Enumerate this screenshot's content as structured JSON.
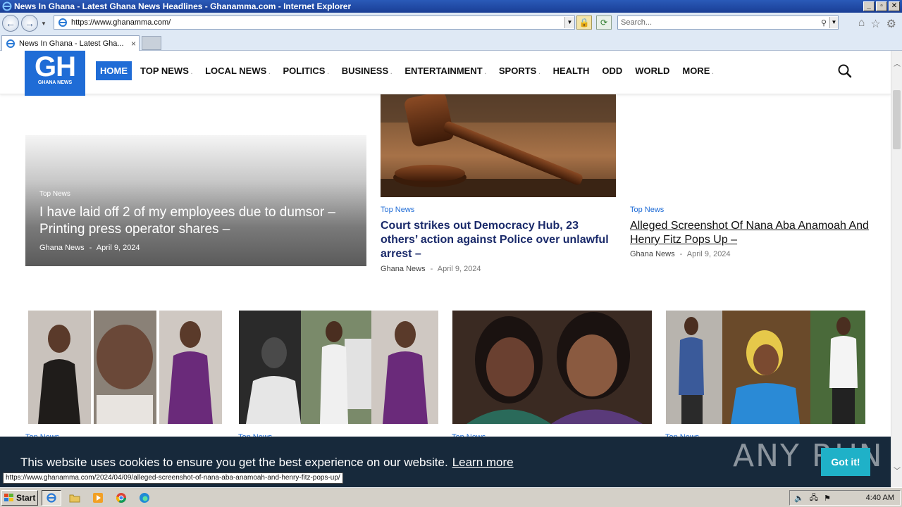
{
  "window": {
    "title": "News In Ghana - Latest Ghana News Headlines - Ghanamma.com - Internet Explorer",
    "buttons": {
      "minimize": "_",
      "maximize": "▫",
      "close": "✕"
    }
  },
  "addressbar": {
    "url": "https://www.ghanamma.com/",
    "search_placeholder": "Search..."
  },
  "tabs": [
    {
      "label": "News In Ghana - Latest Gha...",
      "close": "×"
    }
  ],
  "site": {
    "logo": {
      "main": "GH",
      "sub": "GHANA NEWS"
    },
    "menu": [
      {
        "label": "HOME",
        "active": true,
        "dropdown": false
      },
      {
        "label": "TOP NEWS",
        "dropdown": true
      },
      {
        "label": "LOCAL NEWS",
        "dropdown": true
      },
      {
        "label": "POLITICS",
        "dropdown": true
      },
      {
        "label": "BUSINESS",
        "dropdown": true
      },
      {
        "label": "ENTERTAINMENT",
        "dropdown": true
      },
      {
        "label": "SPORTS",
        "dropdown": true
      },
      {
        "label": "HEALTH",
        "dropdown": false
      },
      {
        "label": "ODD",
        "dropdown": false
      },
      {
        "label": "WORLD",
        "dropdown": false
      },
      {
        "label": "MORE",
        "dropdown": true
      }
    ],
    "dropdown_marker": "."
  },
  "featured": {
    "left": {
      "category": "Top News",
      "title": "I have laid off 2 of my employees due to dumsor – Printing press operator shares –",
      "author": "Ghana News",
      "sep": "-",
      "date": "April 9, 2024"
    },
    "mid": {
      "category": "Top News",
      "title": "Court strikes out Democracy Hub, 23 others’ action against Police over unlawful arrest –",
      "author": "Ghana News",
      "sep": "-",
      "date": "April 9, 2024"
    },
    "right": {
      "category": "Top News",
      "title": "Alleged Screenshot Of Nana Aba Anamoah And Henry Fitz Pops Up –",
      "author": "Ghana News",
      "sep": "-",
      "date": "April 9, 2024"
    }
  },
  "thumbs": [
    {
      "category": "Top News"
    },
    {
      "category": "Top News"
    },
    {
      "category": "Top News"
    },
    {
      "category": "Top News"
    }
  ],
  "cookie": {
    "message": "This website uses cookies to ensure you get the best experience on our website.",
    "learn_more": "Learn more",
    "accept": "Got it!"
  },
  "watermark": "ANY RUN",
  "status_url": "https://www.ghanamma.com/2024/04/09/alleged-screenshot-of-nana-aba-anamoah-and-henry-fitz-pops-up/",
  "taskbar": {
    "start": "Start",
    "clock": "4:40 AM"
  },
  "colors": {
    "brand_blue": "#1f6cd6",
    "cookie_bg": "#17293b",
    "cookie_btn": "#1fb1c8",
    "headline_navy": "#1a2a6a"
  }
}
